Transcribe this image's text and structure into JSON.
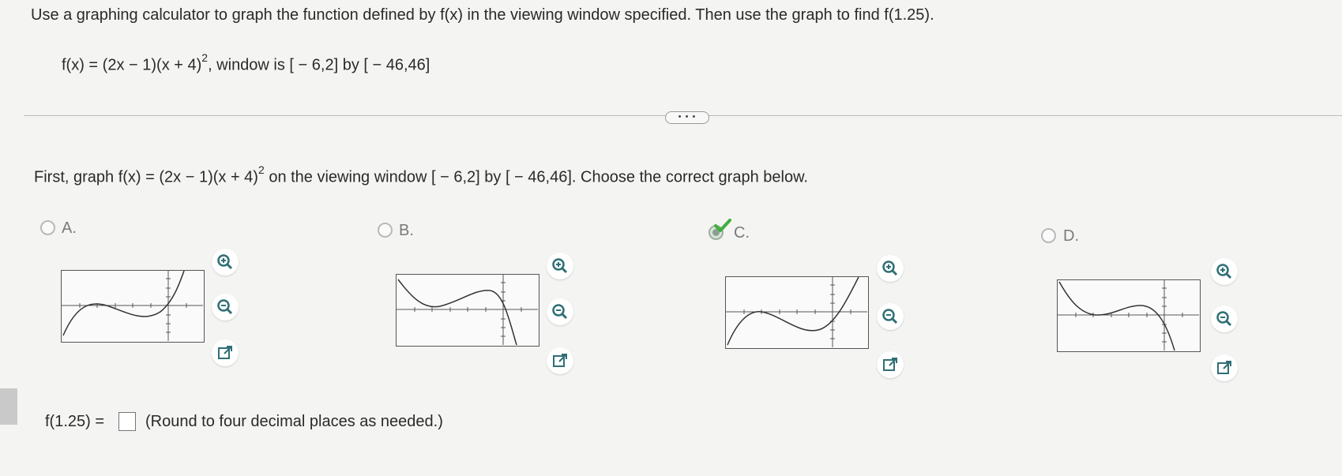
{
  "question": {
    "prompt": "Use a graphing calculator to graph the function defined by f(x) in the viewing window specified. Then use the graph to find f(1.25).",
    "function_lhs": "f(x) = (2x − 1)(x + 4)",
    "exponent": "2",
    "window_text": ",  window is [ − 6,2] by [ − 46,46]"
  },
  "more_button_label": "• • •",
  "part1": {
    "instruction_pre": "First, graph f(x) = (2x − 1)(x + 4)",
    "exponent": "2",
    "instruction_post": " on the viewing window [ − 6,2] by [ − 46,46]. Choose the correct graph below."
  },
  "options": [
    {
      "label": "A.",
      "selected": false
    },
    {
      "label": "B.",
      "selected": false
    },
    {
      "label": "C.",
      "selected": true
    },
    {
      "label": "D.",
      "selected": false
    }
  ],
  "answer": {
    "prefix": "f(1.25) =",
    "value": "",
    "note": "(Round to four decimal places as needed.)"
  },
  "colors": {
    "correct_check": "#3fae3f",
    "icon_teal": "#2f6f75"
  }
}
